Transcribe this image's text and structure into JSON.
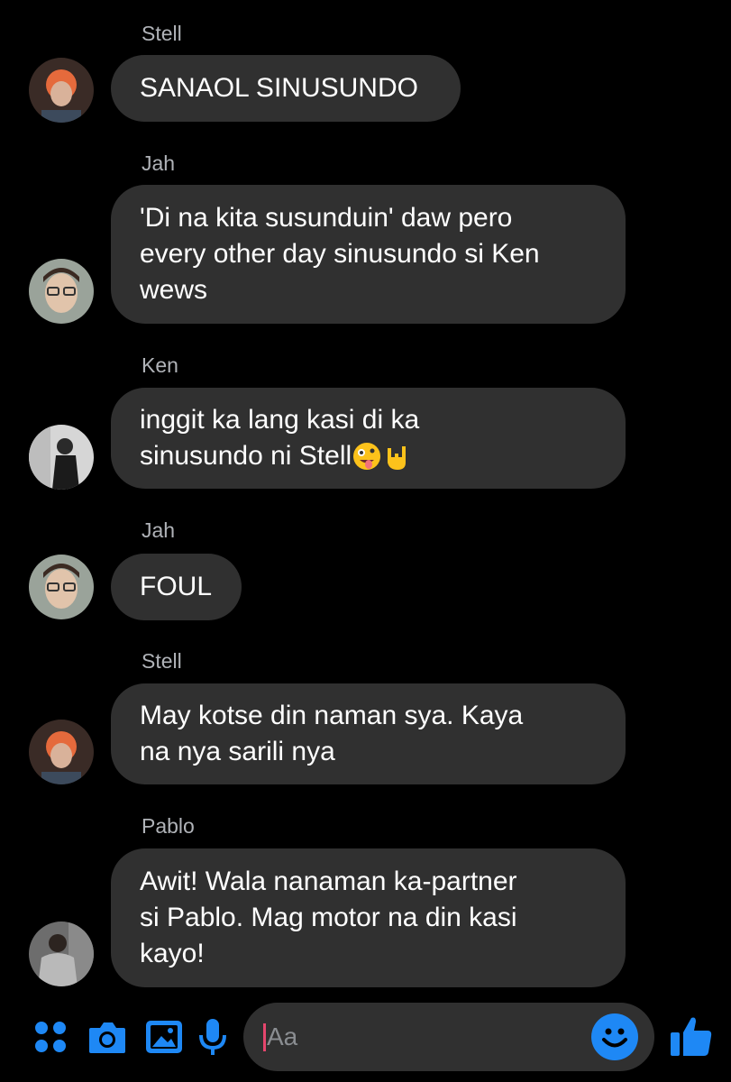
{
  "theme": {
    "background": "#000000",
    "bubble": "#303030",
    "sender_text": "#b0b3b8",
    "accent": "#1e88f5",
    "caret": "#e5466d"
  },
  "messages": [
    {
      "sender": "Stell",
      "avatar": "avatar-stell-red-hair",
      "lines": [
        "SANAOL SINUSUNDO"
      ]
    },
    {
      "sender": "Jah",
      "avatar": "avatar-jah-glasses",
      "lines": [
        "'Di na kita susunduin' daw pero",
        "every other day sinusundo si Ken",
        "wews"
      ]
    },
    {
      "sender": "Ken",
      "avatar": "avatar-ken-grayscale",
      "lines": [
        "inggit ka lang kasi di ka",
        "sinusundo ni Stell"
      ],
      "emojis": [
        "zany-face-emoji",
        "love-you-gesture-emoji"
      ]
    },
    {
      "sender": "Jah",
      "avatar": "avatar-jah-glasses",
      "lines": [
        "FOUL"
      ]
    },
    {
      "sender": "Stell",
      "avatar": "avatar-stell-red-hair",
      "lines": [
        "May kotse din naman sya. Kaya",
        "na nya sarili nya"
      ]
    },
    {
      "sender": "Pablo",
      "avatar": "avatar-pablo",
      "lines": [
        "Awit! Wala nanaman ka-partner",
        "si Pablo. Mag motor na din kasi",
        "kayo!"
      ]
    }
  ],
  "composer": {
    "placeholder": "Aa",
    "tools": [
      "menu-dots-icon",
      "camera-icon",
      "gallery-icon",
      "microphone-icon"
    ],
    "emoji_button": "emoji-icon",
    "like_button": "thumbs-up-icon"
  }
}
